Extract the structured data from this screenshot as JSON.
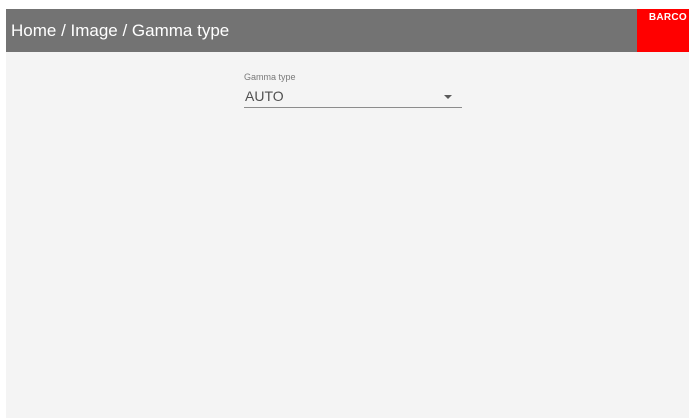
{
  "header": {
    "breadcrumb": "Home / Image / Gamma type",
    "brand_text": "BARCO",
    "brand_color": "#ff0000",
    "header_color": "#737373"
  },
  "main": {
    "gamma_field": {
      "label": "Gamma type",
      "value": "AUTO",
      "icon": "chevron-down-icon"
    }
  }
}
